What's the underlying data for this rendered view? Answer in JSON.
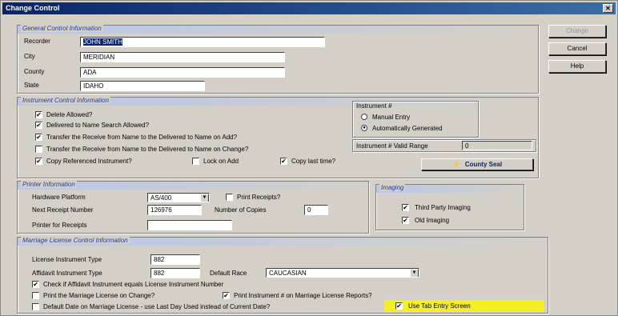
{
  "window": {
    "title": "Change Control",
    "close_glyph": "✕"
  },
  "buttons": {
    "change": "Change",
    "cancel": "Cancel",
    "help": "Help",
    "county_seal": "County Seal"
  },
  "general": {
    "title": "General Control Information",
    "recorder_label": "Recorder",
    "recorder_value": "JOHN SMITH",
    "city_label": "City",
    "city_value": "MERIDIAN",
    "county_label": "County",
    "county_value": "ADA",
    "state_label": "State",
    "state_value": "IDAHO"
  },
  "instrument": {
    "title": "Instrument Control Information",
    "delete_allowed": "Delete Allowed?",
    "delivered_allowed": "Delivered to Name Search Allowed?",
    "transfer_add": "Transfer the Receive from Name to the Delivered to Name on Add?",
    "transfer_change": "Transfer the Receive from Name to the Delivered to Name on Change?",
    "copy_ref": "Copy Referenced Instrument?",
    "lock_add": "Lock on Add",
    "copy_last": "Copy last time?",
    "num_title": "Instrument #",
    "manual": "Manual Entry",
    "auto": "Automatically Generated",
    "valid_range_label": "Instrument # Valid Range",
    "valid_range_value": "0"
  },
  "printer": {
    "title": "Printer Information",
    "platform_label": "Hardware Platform",
    "platform_value": "AS/400",
    "print_receipts": "Print Receipts?",
    "next_receipt_label": "Next Receipt Number",
    "next_receipt_value": "126976",
    "copies_label": "Number of Copies",
    "copies_value": "0",
    "printer_receipts_label": "Printer for Receipts",
    "printer_receipts_value": ""
  },
  "imaging": {
    "title": "Imaging",
    "third_party": "Third Party Imaging",
    "old_imaging": "Old Imaging"
  },
  "marriage": {
    "title": "Marriage License Control Information",
    "license_type_label": "License Instrument Type",
    "license_type_value": "882",
    "affidavit_type_label": "Affidavit Instrument Type",
    "affidavit_type_value": "882",
    "default_race_label": "Default Race",
    "default_race_value": "CAUCASIAN",
    "check_affidavit": "Check if Affidavit Instrument equals License Instrument Number",
    "print_on_change": "Print the Marriage License on Change?",
    "print_instr_reports": "Print Instrument # on Marriage License Reports?",
    "default_date": "Default Date on Marriage License - use Last Day Used instead of Current Date?",
    "use_tab_entry": "Use Tab Entry Screen"
  },
  "check": "✔"
}
